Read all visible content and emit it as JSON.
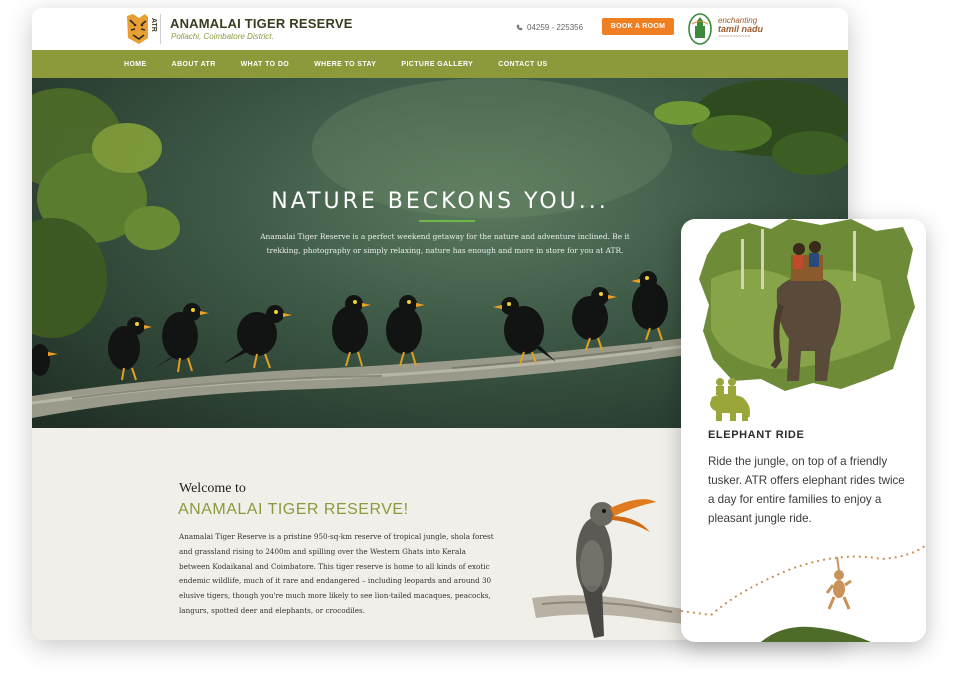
{
  "header": {
    "site_title": "ANAMALAI TIGER RESERVE",
    "site_subtitle": "Pollachi, Coimbatore District.",
    "logo_text": "ATR",
    "phone": "04259 - 225356",
    "book_button": "BOOK A ROOM",
    "tn_logo_line1": "enchanting",
    "tn_logo_line2": "tamil nadu"
  },
  "nav": {
    "items": [
      "HOME",
      "ABOUT ATR",
      "WHAT TO DO",
      "WHERE TO STAY",
      "PICTURE GALLERY",
      "CONTACT US"
    ]
  },
  "hero": {
    "title": "NATURE BECKONS YOU...",
    "text": "Anamalai Tiger Reserve is a perfect weekend getaway for the nature and adventure inclined. Be it trekking, photography or simply relaxing, nature has enough and more in store for you at ATR."
  },
  "welcome": {
    "pre": "Welcome to",
    "title": "ANAMALAI TIGER RESERVE!",
    "body": "Anamalai Tiger Reserve is a pristine 950-sq-km reserve of tropical jungle, shola forest and grassland rising to 2400m and spilling over the Western Ghats into Kerala between Kodaikanal and Coimbatore. This tiger reserve is home to all kinds of exotic endemic wildlife, much of it rare and endangered – including leopards and around 30 elusive tigers, though you're much more likely to see lion-tailed macaques, peacocks, langurs, spotted deer and elephants, or crocodiles."
  },
  "mobile_card": {
    "title": "ELEPHANT RIDE",
    "text": "Ride the jungle, on top of a friendly tusker. ATR offers elephant rides twice a day for entire families to enjoy a pleasant jungle ride."
  },
  "colors": {
    "nav_green": "#8d9a3c",
    "accent_orange": "#f07f22",
    "hero_underline": "#6fb84c",
    "icon_green": "#9aa63a",
    "monkey_tan": "#c8925a"
  },
  "icons": [
    "tiger-logo-icon",
    "phone-icon",
    "tn-emblem-icon",
    "elephant-icon",
    "monkey-icon"
  ]
}
